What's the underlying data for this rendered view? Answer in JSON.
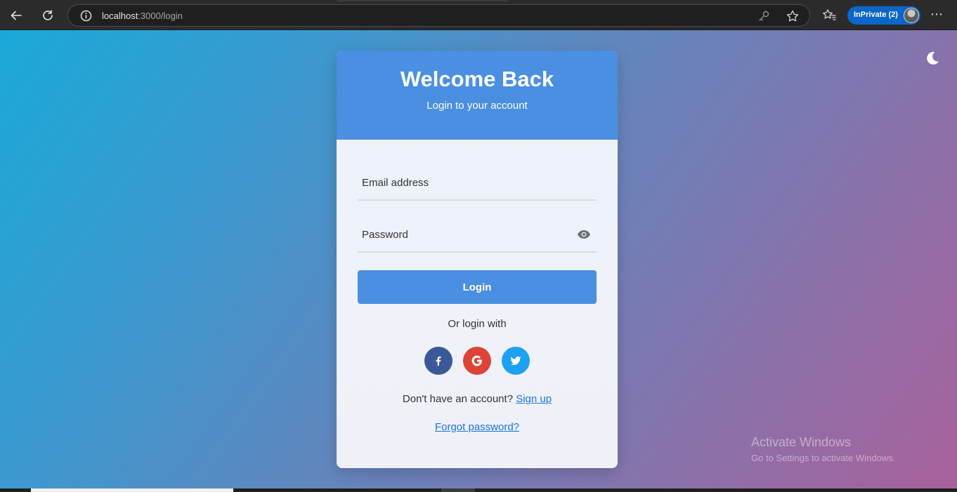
{
  "browser": {
    "url_host": "localhost",
    "url_path": ":3000/login",
    "inprivate_label": "InPrivate (2)"
  },
  "login": {
    "title": "Welcome Back",
    "subtitle": "Login to your account",
    "email_placeholder": "Email address",
    "password_placeholder": "Password",
    "login_button": "Login",
    "or_text": "Or login with",
    "no_account_text": "Don't have an account?",
    "signup_link": "Sign up",
    "forgot_link": "Forgot password?"
  },
  "social_icons": [
    "facebook-icon",
    "google-icon",
    "twitter-icon"
  ],
  "watermark": {
    "title": "Activate Windows",
    "subtitle": "Go to Settings to activate Windows."
  },
  "colors": {
    "accent": "#4a8fe2",
    "facebook": "#3b5998",
    "google": "#db4437",
    "twitter": "#1da1f2",
    "link": "#1a73e8"
  }
}
